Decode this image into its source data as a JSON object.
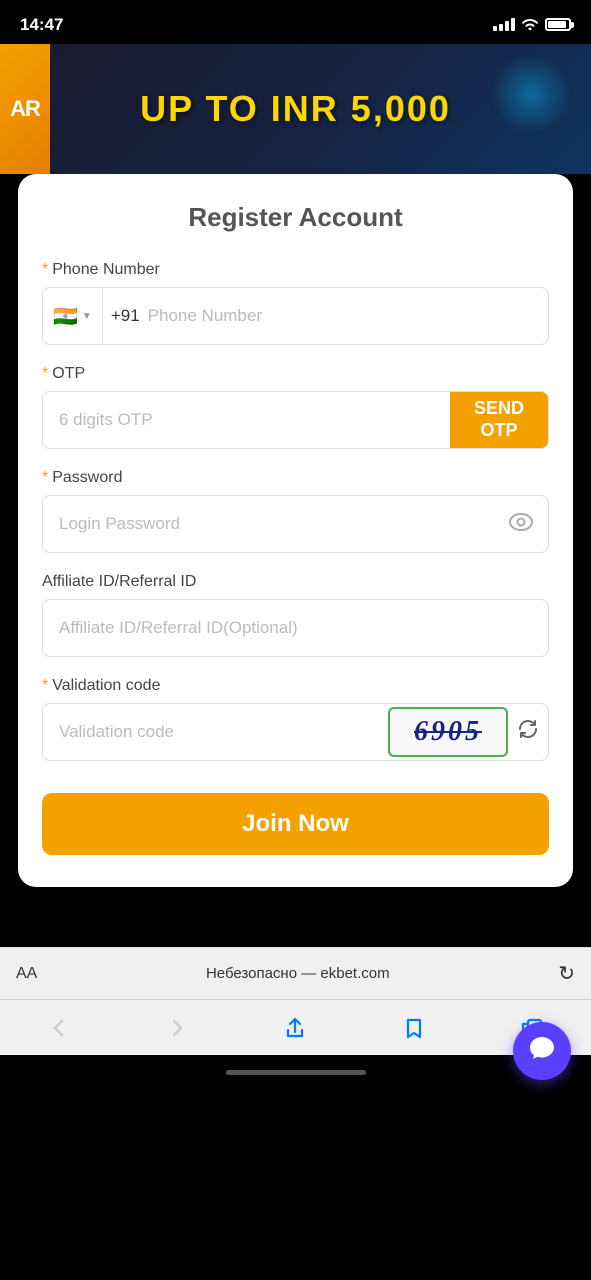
{
  "statusBar": {
    "time": "14:47"
  },
  "banner": {
    "arLabel": "AR",
    "text": "UP TO INR 5,000"
  },
  "form": {
    "title": "Register Account",
    "phoneField": {
      "label": "Phone Number",
      "required": true,
      "countryCode": "+91",
      "flag": "🇮🇳",
      "placeholder": "Phone Number"
    },
    "otpField": {
      "label": "OTP",
      "required": true,
      "placeholder": "6 digits OTP",
      "sendButtonLine1": "SEND",
      "sendButtonLine2": "OTP"
    },
    "passwordField": {
      "label": "Password",
      "required": true,
      "placeholder": "Login Password"
    },
    "affiliateField": {
      "label": "Affiliate ID/Referral ID",
      "required": false,
      "placeholder": "Affiliate ID/Referral ID(Optional)"
    },
    "validationField": {
      "label": "Validation code",
      "required": true,
      "placeholder": "Validation code",
      "captchaValue": "6905"
    },
    "joinButton": "Join Now"
  },
  "browser": {
    "aaLabel": "AA",
    "url": "Небезопасно — ekbet.com",
    "refreshIcon": "↻"
  },
  "chat": {
    "icon": "💬"
  }
}
